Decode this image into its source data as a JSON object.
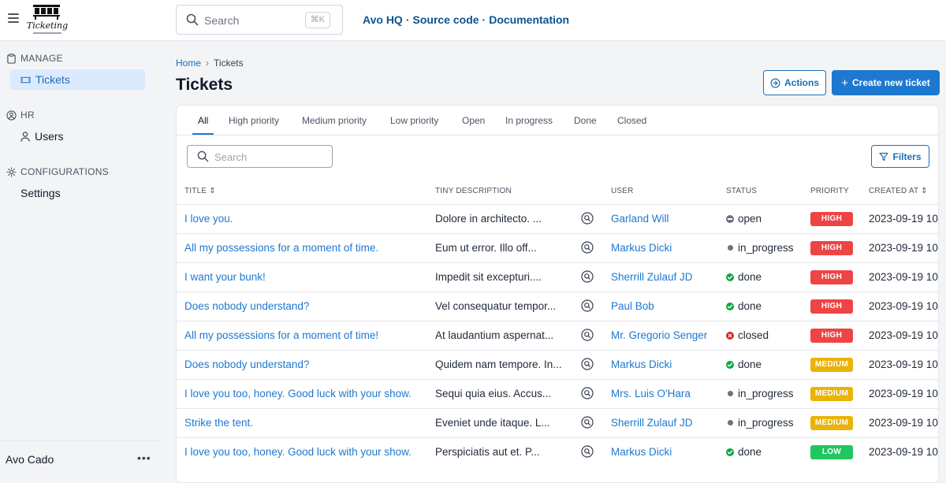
{
  "app": {
    "logo_text": "Ticketing",
    "search_placeholder": "Search",
    "search_shortcut": "⌘K",
    "links": [
      "Avo HQ",
      "Source code",
      "Documentation"
    ],
    "link_separator": "·"
  },
  "sidebar": {
    "sections": [
      {
        "title": "MANAGE",
        "icon": "clipboard-icon",
        "items": [
          {
            "label": "Tickets",
            "icon": "ticket-icon",
            "active": true
          }
        ]
      },
      {
        "title": "HR",
        "icon": "user-circle-icon",
        "items": [
          {
            "label": "Users",
            "icon": "user-icon",
            "active": false
          }
        ]
      },
      {
        "title": "CONFIGURATIONS",
        "icon": "gear-icon",
        "items": [
          {
            "label": "Settings",
            "icon": "",
            "active": false
          }
        ]
      }
    ],
    "footer_user": "Avo Cado",
    "footer_menu": "•••"
  },
  "breadcrumb": {
    "home": "Home",
    "current": "Tickets"
  },
  "page_title": "Tickets",
  "buttons": {
    "actions": "Actions",
    "create": "Create new ticket",
    "filters": "Filters"
  },
  "tabs": [
    "All",
    "High priority",
    "Medium priority",
    "Low priority",
    "Open",
    "In progress",
    "Done",
    "Closed"
  ],
  "table_search_placeholder": "Search",
  "columns": {
    "title": "TITLE",
    "description": "TINY DESCRIPTION",
    "user": "USER",
    "status": "STATUS",
    "priority": "PRIORITY",
    "created_at": "CREATED AT"
  },
  "colors": {
    "accent": "#1d78d0",
    "status": {
      "open": "#6b7280",
      "in_progress": "#6b7280",
      "done": "#16a34a",
      "closed": "#dc2626"
    },
    "priority": {
      "HIGH": "#ef4444",
      "MEDIUM": "#eab308",
      "LOW": "#22c55e"
    }
  },
  "rows": [
    {
      "title": "I love you.",
      "description": "Dolore in architecto. ...",
      "user": "Garland Will",
      "status": "open",
      "priority": "HIGH",
      "created_at": "2023-09-19 10"
    },
    {
      "title": "All my possessions for a moment of time.",
      "description": "Eum ut error. Illo off...",
      "user": "Markus Dicki",
      "status": "in_progress",
      "priority": "HIGH",
      "created_at": "2023-09-19 10"
    },
    {
      "title": "I want your bunk!",
      "description": "Impedit sit excepturi....",
      "user": "Sherrill Zulauf JD",
      "status": "done",
      "priority": "HIGH",
      "created_at": "2023-09-19 10"
    },
    {
      "title": "Does nobody understand?",
      "description": "Vel consequatur tempor...",
      "user": "Paul Bob",
      "status": "done",
      "priority": "HIGH",
      "created_at": "2023-09-19 10"
    },
    {
      "title": "All my possessions for a moment of time!",
      "description": "At laudantium aspernat...",
      "user": "Mr. Gregorio Senger",
      "status": "closed",
      "priority": "HIGH",
      "created_at": "2023-09-19 10"
    },
    {
      "title": "Does nobody understand?",
      "description": "Quidem nam tempore. In...",
      "user": "Markus Dicki",
      "status": "done",
      "priority": "MEDIUM",
      "created_at": "2023-09-19 10"
    },
    {
      "title": "I love you too, honey. Good luck with your show.",
      "description": "Sequi quia eius. Accus...",
      "user": "Mrs. Luis O'Hara",
      "status": "in_progress",
      "priority": "MEDIUM",
      "created_at": "2023-09-19 10"
    },
    {
      "title": "Strike the tent.",
      "description": "Eveniet unde itaque. L...",
      "user": "Sherrill Zulauf JD",
      "status": "in_progress",
      "priority": "MEDIUM",
      "created_at": "2023-09-19 10"
    },
    {
      "title": "I love you too, honey. Good luck with your show.",
      "description": "Perspiciatis aut et. P...",
      "user": "Markus Dicki",
      "status": "done",
      "priority": "LOW",
      "created_at": "2023-09-19 10"
    }
  ]
}
